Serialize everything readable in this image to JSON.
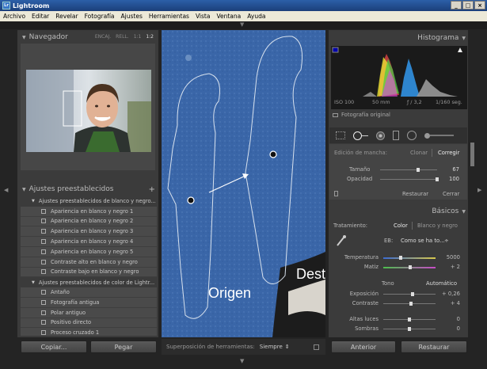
{
  "window": {
    "title": "Lightroom",
    "app_badge": "Lr"
  },
  "window_buttons": [
    "_",
    "□",
    "×"
  ],
  "menu": [
    "Archivo",
    "Editar",
    "Revelar",
    "Fotografía",
    "Ajustes",
    "Herramientas",
    "Vista",
    "Ventana",
    "Ayuda"
  ],
  "navigator": {
    "title": "Navegador",
    "zooms": [
      "ENCAJ.",
      "RELL.",
      "1:1",
      "1:2"
    ],
    "active_zoom": "1:2"
  },
  "presets": {
    "title": "Ajustes preestablecidos",
    "add_symbol": "+",
    "rows": [
      {
        "type": "folder",
        "label": "Ajustes preestablecidos de blanco y negro..."
      },
      {
        "type": "item",
        "label": "Apariencia en blanco y negro 1"
      },
      {
        "type": "item",
        "label": "Apariencia en blanco y negro 2"
      },
      {
        "type": "item",
        "label": "Apariencia en blanco y negro 3"
      },
      {
        "type": "item",
        "label": "Apariencia en blanco y negro 4"
      },
      {
        "type": "item",
        "label": "Apariencia en blanco y negro 5"
      },
      {
        "type": "item",
        "label": "Contraste alto en blanco y negro"
      },
      {
        "type": "item",
        "label": "Contraste bajo en blanco y negro"
      },
      {
        "type": "folder",
        "label": "Ajustes preestablecidos de color de Lightr..."
      },
      {
        "type": "item",
        "label": "Antaño"
      },
      {
        "type": "item",
        "label": "Fotografía antigua"
      },
      {
        "type": "item",
        "label": "Polar antiguo"
      },
      {
        "type": "item",
        "label": "Positivo directo"
      },
      {
        "type": "item",
        "label": "Proceso cruzado 1"
      }
    ]
  },
  "left_buttons": {
    "copy": "Copiar...",
    "paste": "Pegar"
  },
  "canvas": {
    "label_origin": "Origen",
    "label_dest": "Destino"
  },
  "toolbar": {
    "overlay_label": "Superposición de herramientas:",
    "overlay_value": "Siempre",
    "overlay_chevron": "⇕"
  },
  "histogram": {
    "title": "Histograma",
    "iso": "ISO 100",
    "focal": "50 mm",
    "aperture": "ƒ / 3,2",
    "shutter": "1/160 seg.",
    "original_label": "Fotografía original"
  },
  "spot": {
    "mode_label": "Edición de mancha:",
    "clone": "Clonar",
    "heal": "Corregir",
    "active_mode": "Corregir",
    "size_label": "Tamaño",
    "size_value": "67",
    "size_fraction": 0.67,
    "opacity_label": "Opacidad",
    "opacity_value": "100",
    "opacity_fraction": 1.0,
    "reset": "Restaurar",
    "close": "Cerrar"
  },
  "basic": {
    "title": "Básicos",
    "treatment_label": "Tratamiento:",
    "color": "Color",
    "bw": "Blanco y negro",
    "wb_label": "EB:",
    "wb_value": "Como se ha to...",
    "wb_chevron": "÷",
    "temp_label": "Temperatura",
    "temp_value": "5000",
    "tint_label": "Matiz",
    "tint_value": "+ 2",
    "tone_label": "Tono",
    "auto": "Automático",
    "exposure_label": "Exposición",
    "exposure_value": "+ 0,26",
    "contrast_label": "Contraste",
    "contrast_value": "+ 4",
    "highlights_label": "Altas luces",
    "highlights_value": "0",
    "shadows_label": "Sombras",
    "shadows_value": "0"
  },
  "right_buttons": {
    "previous": "Anterior",
    "reset": "Restaurar"
  },
  "colors": {
    "canvas_blue": "#3a66a8",
    "title_blue": "#2c5fa8",
    "panel": "#3b3b3b"
  }
}
